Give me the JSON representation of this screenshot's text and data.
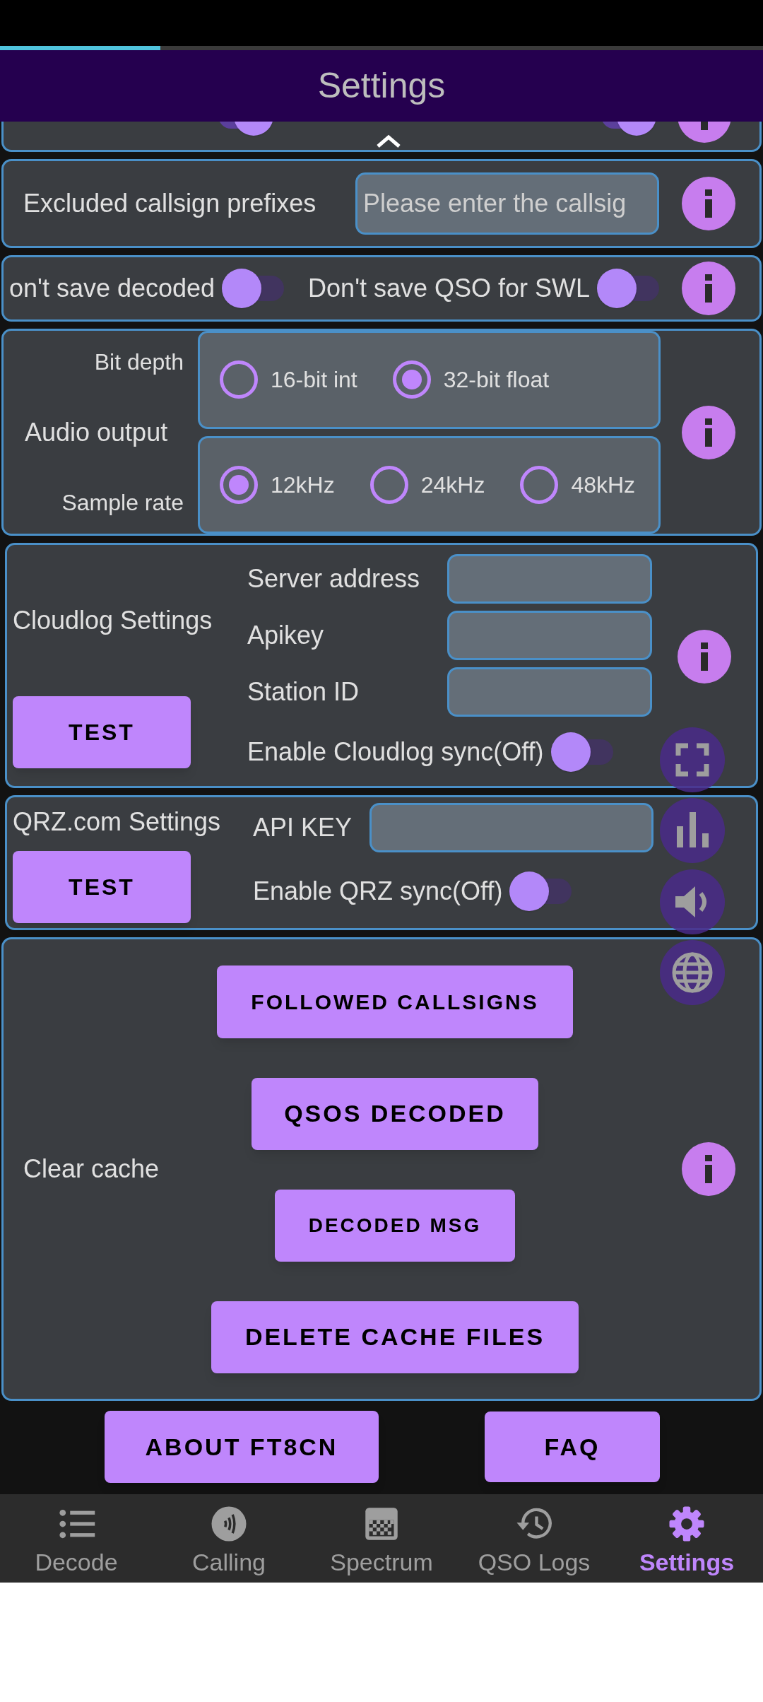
{
  "header": {
    "title": "Settings",
    "progress": {
      "level": 0.21
    }
  },
  "auto_row": {
    "items": [
      {
        "on": true
      },
      {
        "on": true
      }
    ]
  },
  "excluded_prefixes": {
    "label": "Excluded callsign prefixes",
    "placeholder": "Please enter the callsig"
  },
  "save_row": {
    "items": [
      {
        "label": "on't save decoded",
        "on": false
      },
      {
        "label": "Don't save QSO for SWL",
        "on": false
      }
    ]
  },
  "audio_output": {
    "label": "Audio output",
    "groups": [
      {
        "label": "Bit depth",
        "options": [
          {
            "label": "16-bit int",
            "selected": false
          },
          {
            "label": "32-bit float",
            "selected": true
          }
        ]
      },
      {
        "label": "Sample rate",
        "options": [
          {
            "label": "12kHz",
            "selected": true
          },
          {
            "label": "24kHz",
            "selected": false
          },
          {
            "label": "48kHz",
            "selected": false
          }
        ]
      }
    ]
  },
  "cloudlog": {
    "title": "Cloudlog Settings",
    "button": "TEST",
    "fields": [
      {
        "label": "Server address"
      },
      {
        "label": "Apikey"
      },
      {
        "label": "Station ID"
      }
    ],
    "sync": {
      "label": "Enable Cloudlog sync(Off)",
      "on": false
    }
  },
  "qrz": {
    "title": "QRZ.com Settings",
    "button": "TEST",
    "fields": [
      {
        "label": "API KEY"
      }
    ],
    "sync": {
      "label": "Enable QRZ sync(Off)",
      "on": false
    }
  },
  "clear_cache": {
    "label": "Clear cache",
    "buttons": [
      "FOLLOWED CALLSIGNS",
      "QSOS DECODED",
      "DECODED MSG",
      "DELETE CACHE FILES"
    ]
  },
  "footer_buttons": [
    "ABOUT FT8CN",
    "FAQ"
  ],
  "nav": [
    {
      "label": "Decode",
      "selected": false
    },
    {
      "label": "Calling",
      "selected": false
    },
    {
      "label": "Spectrum",
      "selected": false
    },
    {
      "label": "QSO Logs",
      "selected": false
    },
    {
      "label": "Settings",
      "selected": true
    }
  ]
}
